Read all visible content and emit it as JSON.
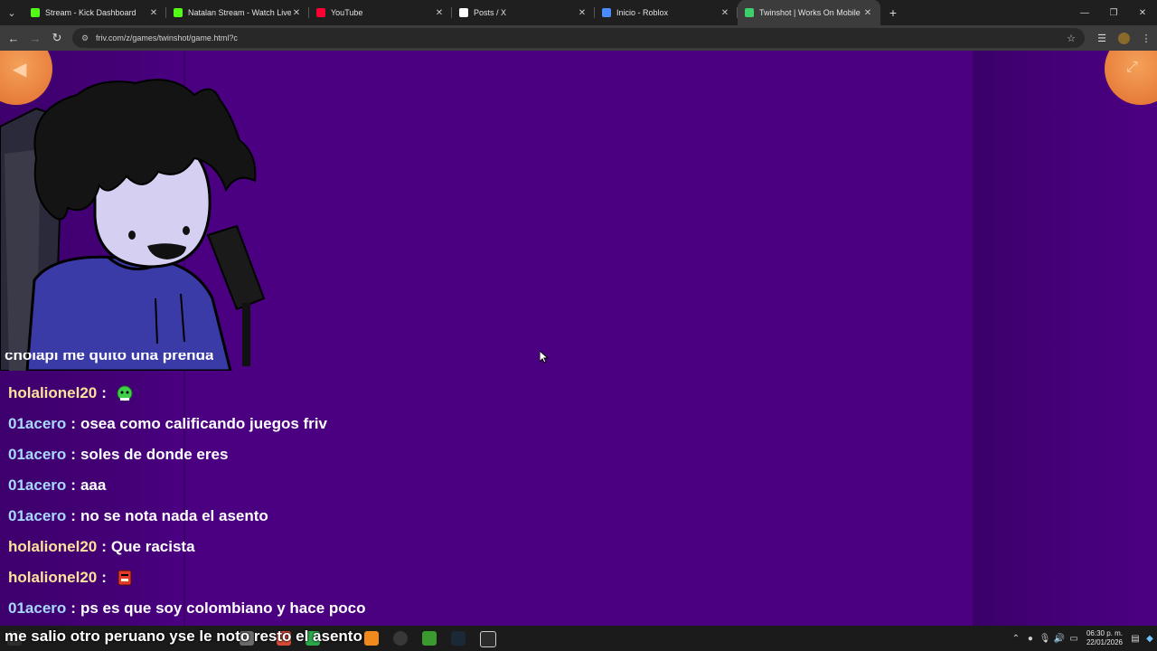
{
  "browser": {
    "tabs": [
      {
        "title": "Stream - Kick Dashboard",
        "icon": "kick-icon",
        "color": "#53fc18",
        "active": false
      },
      {
        "title": "Natalan Stream - Watch Live on",
        "icon": "kick-icon",
        "color": "#53fc18",
        "active": false
      },
      {
        "title": "YouTube",
        "icon": "youtube-icon",
        "color": "#ff0033",
        "active": false
      },
      {
        "title": "Posts / X",
        "icon": "x-icon",
        "color": "#ffffff",
        "active": false
      },
      {
        "title": "Inicio - Roblox",
        "icon": "roblox-icon",
        "color": "#4a8cff",
        "active": false
      },
      {
        "title": "Twinshot | Works On Mobile | P",
        "icon": "friv-icon",
        "color": "#3fcf6a",
        "active": true
      }
    ],
    "new_tab": "+",
    "address": "friv.com/z/games/twinshot/game.html?c"
  },
  "chat": {
    "partial_line": "cholapi me quito una prenda",
    "messages": [
      {
        "user": "holalionel20",
        "text": "",
        "emote": "green-emote",
        "user_color": "gold"
      },
      {
        "user": "01acero",
        "text": "osea como calificando juegos friv",
        "emote": "",
        "user_color": "blue"
      },
      {
        "user": "01acero",
        "text": "soles de donde eres",
        "emote": "",
        "user_color": "blue"
      },
      {
        "user": "01acero",
        "text": "aaa",
        "emote": "",
        "user_color": "blue"
      },
      {
        "user": "01acero",
        "text": "no se nota nada el asento",
        "emote": "",
        "user_color": "blue"
      },
      {
        "user": "holalionel20",
        "text": "Que racista",
        "emote": "",
        "user_color": "gold"
      },
      {
        "user": "holalionel20",
        "text": "",
        "emote": "red-emote",
        "user_color": "gold"
      },
      {
        "user": "01acero",
        "text": "ps es que soy colombiano y hace poco",
        "emote": "",
        "user_color": "blue"
      }
    ],
    "separator": ":",
    "caption": "me salio otro peruano yse le noto resto el asento"
  },
  "taskbar": {
    "time": "06:30 p. m.",
    "date": "22/01/2026"
  },
  "colors": {
    "page_bg": "#4b0082",
    "user_gold": "#ffe39a",
    "user_blue": "#a8d8ff"
  }
}
